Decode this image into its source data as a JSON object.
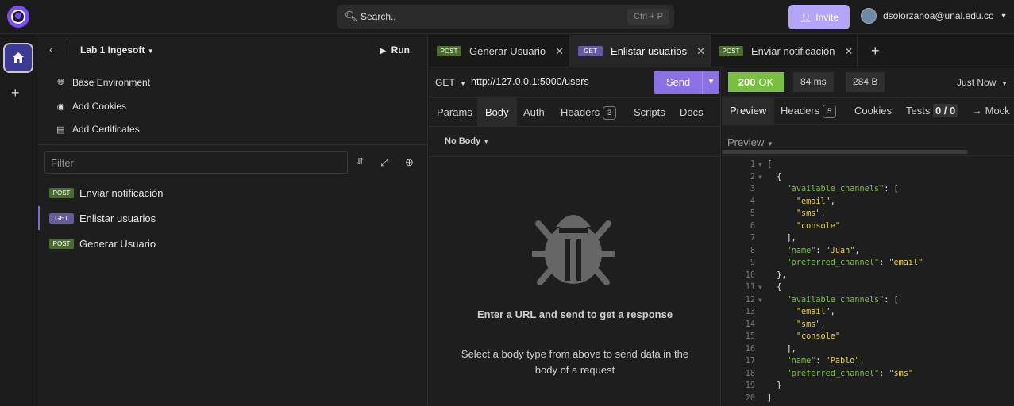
{
  "colors": {
    "accent": "#8b70e6",
    "success": "#7ac040",
    "post_badge": "#4b6d32",
    "get_badge": "#675a9f"
  },
  "topbar": {
    "search_label": "Search..",
    "search_shortcut": "Ctrl + P",
    "invite_label": "Invite",
    "user_email": "dsolorzanoa@unal.edu.co"
  },
  "sidebar": {
    "project_name": "Lab 1 Ingesoft",
    "run_label": "Run",
    "links": [
      "Base Environment",
      "Add Cookies",
      "Add Certificates"
    ],
    "filter_placeholder": "Filter",
    "requests": [
      {
        "method": "POST",
        "name": "Enviar notificación"
      },
      {
        "method": "GET",
        "name": "Enlistar usuarios"
      },
      {
        "method": "POST",
        "name": "Generar Usuario"
      }
    ]
  },
  "tabs": [
    {
      "method": "POST",
      "name": "Generar Usuario"
    },
    {
      "method": "GET",
      "name": "Enlistar usuarios"
    },
    {
      "method": "POST",
      "name": "Enviar notificación"
    }
  ],
  "request": {
    "method": "GET",
    "url": "http://127.0.0.1:5000/users",
    "send_label": "Send",
    "subtabs": [
      "Params",
      "Body",
      "Auth",
      "Headers",
      "Scripts",
      "Docs"
    ],
    "headers_count": "3",
    "body_type": "No Body",
    "empty_title": "Enter a URL and send to get a response",
    "empty_text": "Select a body type from above to send data in the body of a request"
  },
  "response": {
    "status_code": "200",
    "status_text": "OK",
    "time": "84 ms",
    "size": "284 B",
    "when": "Just Now",
    "tabs": [
      "Preview",
      "Headers",
      "Cookies",
      "Tests",
      "→ Mock"
    ],
    "headers_count": "5",
    "tests_result": "0 / 0",
    "preview_mode": "Preview",
    "lines": [
      "[",
      "  {",
      "    \"available_channels\": [",
      "      \"email\",",
      "      \"sms\",",
      "      \"console\"",
      "    ],",
      "    \"name\": \"Juan\",",
      "    \"preferred_channel\": \"email\"",
      "  },",
      "  {",
      "    \"available_channels\": [",
      "      \"email\",",
      "      \"sms\",",
      "      \"console\"",
      "    ],",
      "    \"name\": \"Pablo\",",
      "    \"preferred_channel\": \"sms\"",
      "  }",
      "]"
    ]
  }
}
